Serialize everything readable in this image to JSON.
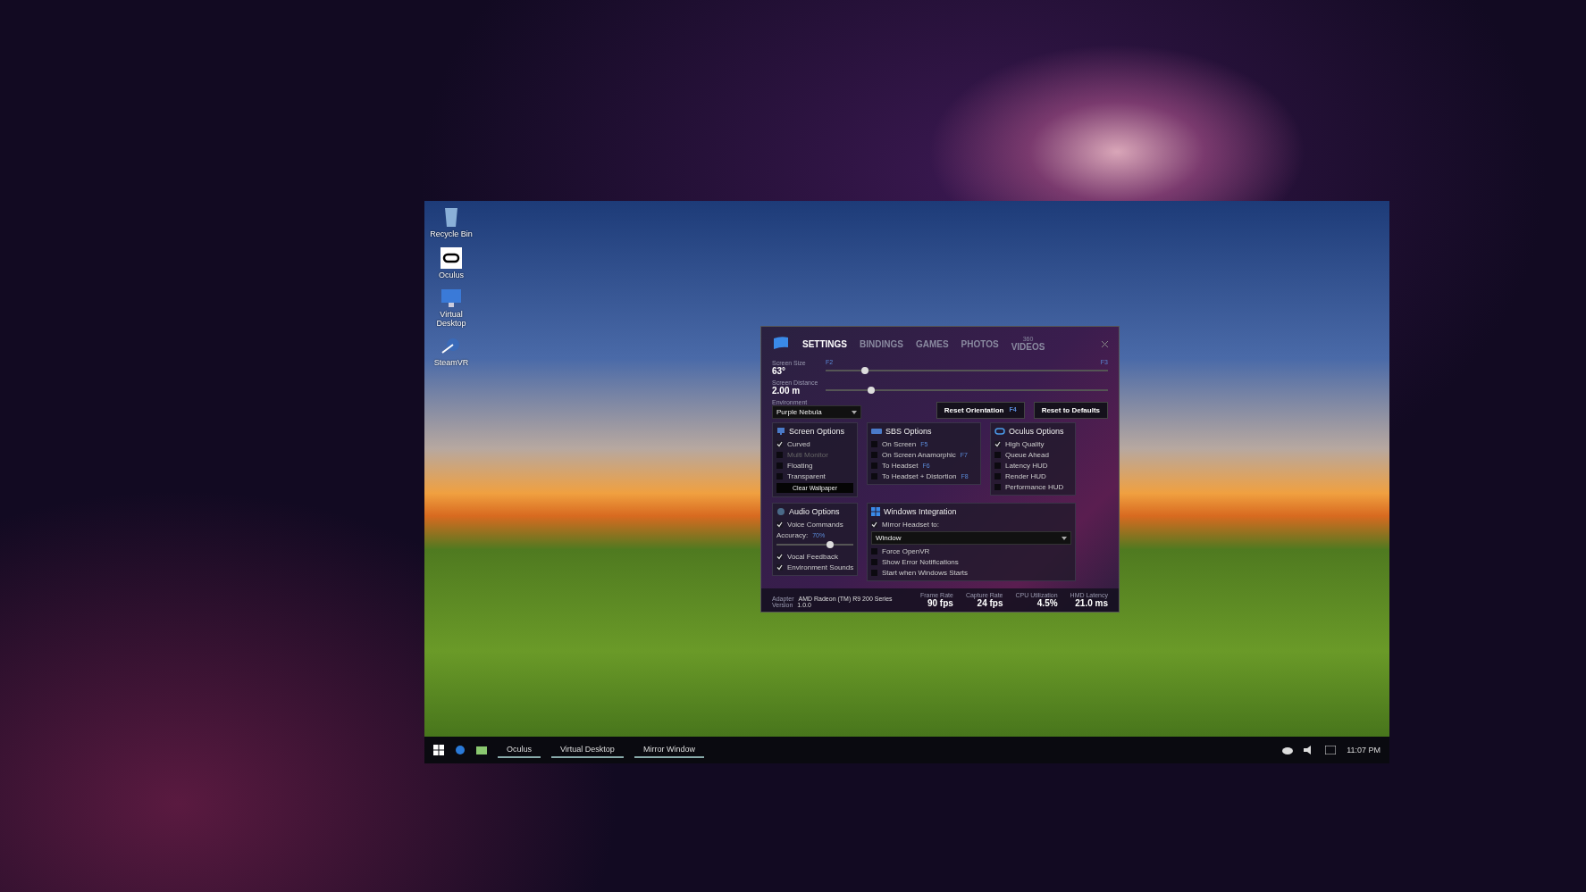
{
  "desktop_icons": [
    {
      "label": "Recycle Bin"
    },
    {
      "label": "Oculus"
    },
    {
      "label": "Virtual Desktop"
    },
    {
      "label": "SteamVR"
    }
  ],
  "settings_window": {
    "tabs": [
      {
        "label": "SETTINGS",
        "selected": true
      },
      {
        "label": "BINDINGS",
        "selected": false
      },
      {
        "label": "GAMES",
        "selected": false
      },
      {
        "label": "PHOTOS",
        "selected": false
      },
      {
        "label": "VIDEOS",
        "selected": false
      }
    ],
    "tab_badge": "360",
    "sliders": [
      {
        "label": "Screen Size",
        "value": "63°",
        "level": 0.14,
        "hotkey_left": "F2",
        "hotkey_right": "F3"
      },
      {
        "label": "Screen Distance",
        "value": "2.00 m",
        "level": 0.16
      }
    ],
    "environment": {
      "label": "Environment",
      "value": "Purple Nebula"
    },
    "buttons": [
      {
        "label": "Reset Orientation",
        "hotkey": "F4"
      },
      {
        "label": "Reset to Defaults"
      }
    ],
    "groups": [
      {
        "title": "Screen Options",
        "items": [
          {
            "kind": "checkbox",
            "label": "Curved",
            "checked": true,
            "disabled": false
          },
          {
            "kind": "checkbox",
            "label": "Multi Monitor",
            "checked": false,
            "disabled": true
          },
          {
            "kind": "checkbox",
            "label": "Floating",
            "checked": false,
            "disabled": false
          },
          {
            "kind": "checkbox",
            "label": "Transparent",
            "checked": false,
            "disabled": false
          },
          {
            "kind": "button",
            "label": "Clear Wallpaper"
          }
        ]
      },
      {
        "title": "SBS Options",
        "items": [
          {
            "kind": "checkbox",
            "label": "On Screen",
            "hotkey": "F5",
            "checked": false,
            "disabled": false
          },
          {
            "kind": "checkbox",
            "label": "On Screen Anamorphic",
            "hotkey": "F7",
            "checked": false,
            "disabled": false
          },
          {
            "kind": "checkbox",
            "label": "To Headset",
            "hotkey": "F6",
            "checked": false,
            "disabled": false
          },
          {
            "kind": "checkbox",
            "label": "To Headset + Distortion",
            "hotkey": "F8",
            "checked": false,
            "disabled": false
          }
        ]
      },
      {
        "title": "Oculus Options",
        "items": [
          {
            "kind": "checkbox",
            "label": "High Quality",
            "checked": true,
            "disabled": false
          },
          {
            "kind": "checkbox",
            "label": "Queue Ahead",
            "checked": false,
            "disabled": false
          },
          {
            "kind": "checkbox",
            "label": "Latency HUD",
            "checked": false,
            "disabled": false
          },
          {
            "kind": "checkbox",
            "label": "Render HUD",
            "checked": false,
            "disabled": false
          },
          {
            "kind": "checkbox",
            "label": "Performance HUD",
            "checked": false,
            "disabled": false
          }
        ]
      },
      {
        "title": "Audio Options",
        "items": [
          {
            "kind": "checkbox",
            "label": "Voice Commands",
            "checked": true,
            "disabled": false
          },
          {
            "kind": "slider",
            "label": "Accuracy:",
            "value": "70%",
            "level": 0.7
          },
          {
            "kind": "checkbox",
            "label": "Vocal Feedback",
            "checked": true,
            "disabled": false
          },
          {
            "kind": "checkbox",
            "label": "Environment Sounds",
            "checked": true,
            "disabled": false
          }
        ]
      },
      {
        "title": "Windows Integration",
        "items": [
          {
            "kind": "checkbox",
            "label": "Mirror Headset to:",
            "checked": true,
            "disabled": false
          },
          {
            "kind": "dropdown",
            "value": "Window"
          },
          {
            "kind": "checkbox",
            "label": "Force OpenVR",
            "checked": false,
            "disabled": false
          },
          {
            "kind": "checkbox",
            "label": "Show Error Notifications",
            "checked": false,
            "disabled": false
          },
          {
            "kind": "checkbox",
            "label": "Start when Windows Starts",
            "checked": false,
            "disabled": false
          }
        ]
      }
    ],
    "info": [
      {
        "label": "Adapter",
        "value": "AMD Radeon (TM) R9 200 Series"
      },
      {
        "label": "Version",
        "value": "1.0.0"
      }
    ],
    "stats": [
      {
        "label": "Frame Rate",
        "value": "90 fps"
      },
      {
        "label": "Capture Rate",
        "value": "24 fps"
      },
      {
        "label": "CPU Utilization",
        "value": "4.5%"
      },
      {
        "label": "HMD Latency",
        "value": "21.0 ms"
      }
    ]
  },
  "taskbar": {
    "tasks": [
      {
        "label": "Oculus"
      },
      {
        "label": "Virtual Desktop"
      },
      {
        "label": "Mirror Window"
      }
    ],
    "clock": "11:07 PM"
  }
}
